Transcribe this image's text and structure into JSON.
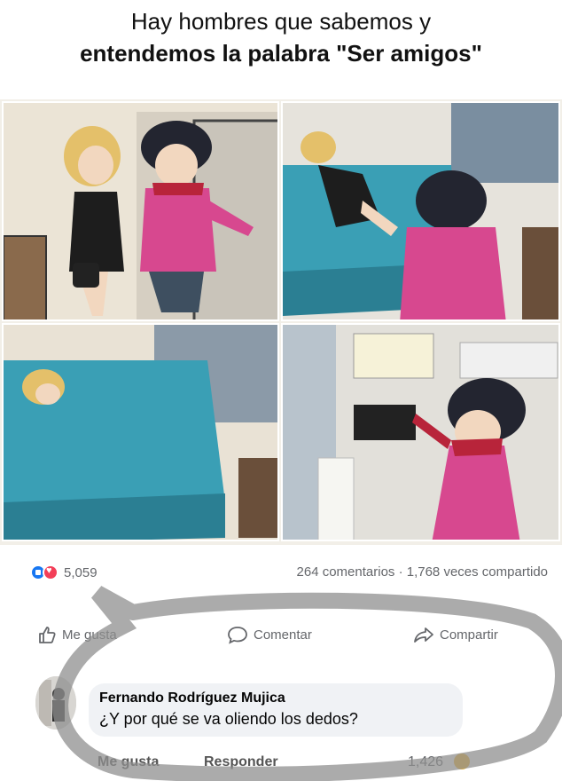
{
  "caption": {
    "line1": "Hay hombres que sabemos y",
    "line2": "entendemos la palabra \"Ser amigos\""
  },
  "post_stats": {
    "reaction_count": "5,059",
    "shares_comments": "264 comentarios · 1,768 veces compartido"
  },
  "actions": {
    "like_label": "Me gusta",
    "comment_label": "Comentar",
    "share_label": "Compartir"
  },
  "comment": {
    "author": "Fernando Rodríguez Mujica",
    "text": "¿Y por qué se va oliendo los dedos?",
    "like_label": "Me gusta",
    "reply_label": "Responder",
    "reaction_count": "1,426"
  },
  "colors": {
    "like_blue": "#1877f2",
    "love_red": "#f33e58",
    "haha_yellow": "#f7b928",
    "bed_teal": "#3a9fb5",
    "shirt_pink": "#d7488f"
  },
  "icons": [
    "like-reaction-icon",
    "love-reaction-icon",
    "thumb-up-icon",
    "comment-icon",
    "share-arrow-icon",
    "haha-reaction-icon"
  ]
}
